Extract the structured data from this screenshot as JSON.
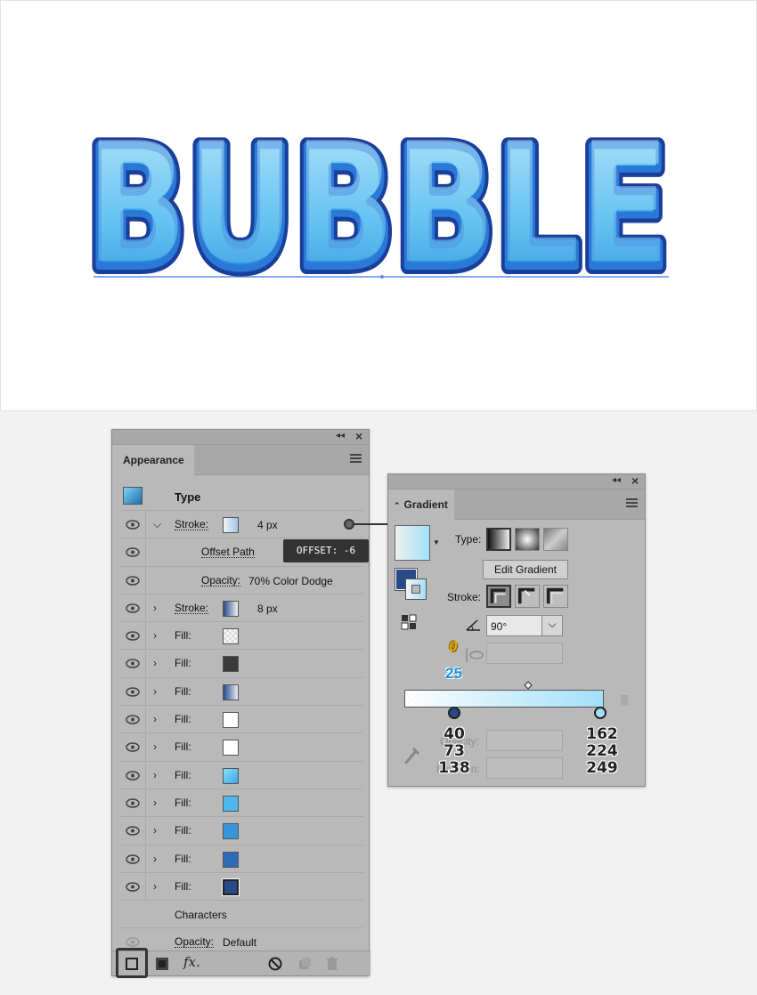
{
  "artwork": {
    "text": "BUBBLE"
  },
  "appearance": {
    "tab": "Appearance",
    "type_label": "Type",
    "rows": [
      {
        "label": "Stroke:",
        "value": "4 px",
        "chevron": "down"
      },
      {
        "label": "Offset Path",
        "value": ""
      },
      {
        "label": "Opacity:",
        "value": "70% Color Dodge"
      },
      {
        "label": "Stroke:",
        "value": "8 px",
        "chevron": "right"
      },
      {
        "label": "Fill:",
        "value": "",
        "chevron": "right"
      },
      {
        "label": "Fill:",
        "value": "",
        "chevron": "right"
      },
      {
        "label": "Fill:",
        "value": "",
        "chevron": "right"
      },
      {
        "label": "Fill:",
        "value": "",
        "chevron": "right"
      },
      {
        "label": "Fill:",
        "value": "",
        "chevron": "right"
      },
      {
        "label": "Fill:",
        "value": "",
        "chevron": "right"
      },
      {
        "label": "Fill:",
        "value": "",
        "chevron": "right"
      },
      {
        "label": "Fill:",
        "value": "",
        "chevron": "right"
      },
      {
        "label": "Fill:",
        "value": "",
        "chevron": "right"
      },
      {
        "label": "Fill:",
        "value": "",
        "chevron": "right"
      }
    ],
    "characters_label": "Characters",
    "opacity_label": "Opacity:",
    "opacity_value": "Default",
    "fx_label": "fx."
  },
  "tooltip": "OFFSET: -6",
  "gradient": {
    "tab": "Gradient",
    "type_label": "Type:",
    "edit_gradient": "Edit Gradient",
    "stroke_label": "Stroke:",
    "angle": "90°",
    "aspect_annotation": "0",
    "aspect_annotation2": "25",
    "opacity_label": "Opacity:",
    "location_label": "Location:",
    "stop_left_rgb": [
      "40",
      "73",
      "138"
    ],
    "stop_right_rgb": [
      "162",
      "224",
      "249"
    ]
  },
  "colors": {
    "accent_dark": "#284a8a",
    "accent_light": "#a2e0f9"
  }
}
